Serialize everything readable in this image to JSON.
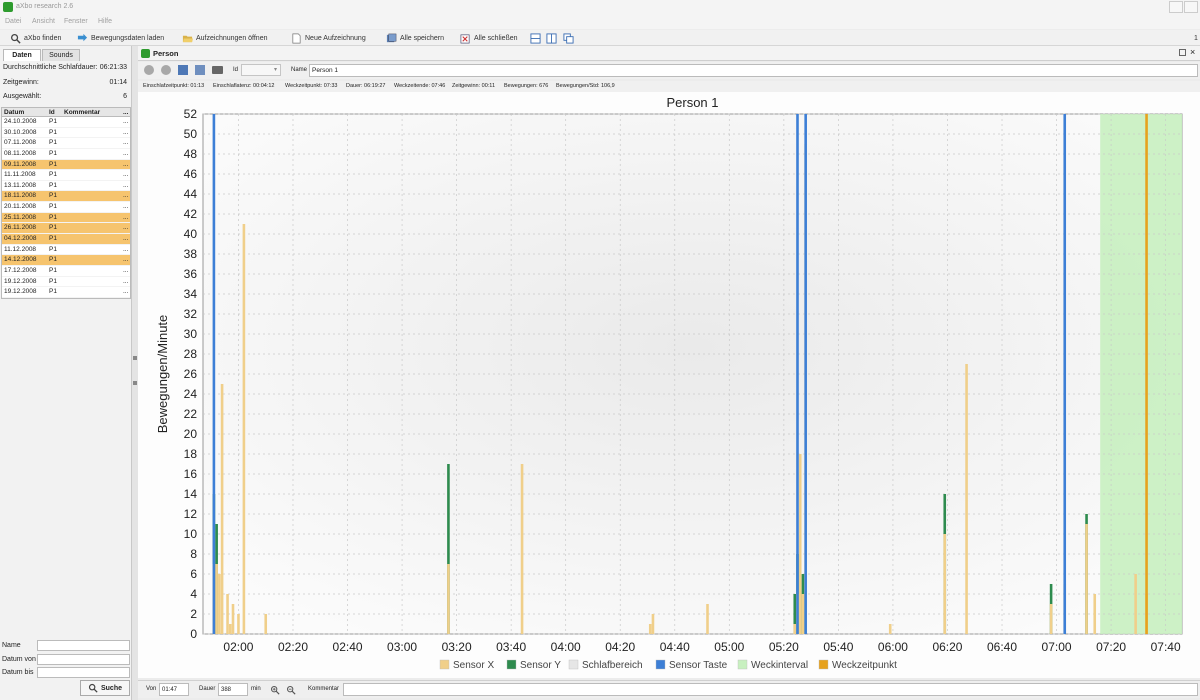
{
  "window": {
    "title": "aXbo research 2.6"
  },
  "menu": [
    "Datei",
    "Ansicht",
    "Fenster",
    "Hilfe"
  ],
  "toolbar": {
    "find": "aXbo finden",
    "load": "Bewegungsdaten laden",
    "open": "Aufzeichnungen öffnen",
    "new": "Neue Aufzeichnung",
    "save_all": "Alle speichern",
    "close_all": "Alle schließen",
    "corner": "1"
  },
  "left": {
    "tabs": [
      "Daten",
      "Sounds"
    ],
    "stats": [
      {
        "label": "Durchschnittliche Schlafdauer:",
        "value": "06:21:33"
      },
      {
        "label": "Zeitgewinn:",
        "value": "01:14"
      },
      {
        "label": "Ausgewählt:",
        "value": "6"
      }
    ],
    "table_headers": [
      "Datum",
      "Id",
      "Kommentar",
      "..."
    ],
    "rows": [
      {
        "date": "24.10.2008",
        "id": "P1",
        "more": "...",
        "hl": false
      },
      {
        "date": "30.10.2008",
        "id": "P1",
        "more": "...",
        "hl": false
      },
      {
        "date": "07.11.2008",
        "id": "P1",
        "more": "...",
        "hl": false
      },
      {
        "date": "08.11.2008",
        "id": "P1",
        "more": "...",
        "hl": false
      },
      {
        "date": "09.11.2008",
        "id": "P1",
        "more": "...",
        "hl": true
      },
      {
        "date": "11.11.2008",
        "id": "P1",
        "more": "...",
        "hl": false
      },
      {
        "date": "13.11.2008",
        "id": "P1",
        "more": "...",
        "hl": false
      },
      {
        "date": "18.11.2008",
        "id": "P1",
        "more": "...",
        "hl": true
      },
      {
        "date": "20.11.2008",
        "id": "P1",
        "more": "...",
        "hl": false
      },
      {
        "date": "25.11.2008",
        "id": "P1",
        "more": "...",
        "hl": true
      },
      {
        "date": "26.11.2008",
        "id": "P1",
        "more": "...",
        "hl": true
      },
      {
        "date": "04.12.2008",
        "id": "P1",
        "more": "...",
        "hl": true
      },
      {
        "date": "11.12.2008",
        "id": "P1",
        "more": "...",
        "hl": false
      },
      {
        "date": "14.12.2008",
        "id": "P1",
        "more": "...",
        "hl": true
      },
      {
        "date": "17.12.2008",
        "id": "P1",
        "more": "...",
        "hl": false
      },
      {
        "date": "19.12.2008",
        "id": "P1",
        "more": "...",
        "hl": false
      },
      {
        "date": "19.12.2008",
        "id": "P1",
        "more": "...",
        "hl": false
      }
    ],
    "filter_labels": [
      "Name",
      "Datum von",
      "Datum bis"
    ],
    "search_label": "Suche"
  },
  "panel": {
    "title": "Person",
    "id_label": "Id",
    "name_label": "Name",
    "name_value": "Person 1"
  },
  "info": [
    "Einschlafzeitpunkt: 01:13",
    "Einschlaflatenz: 00:04:12",
    "Weckzeitpunkt: 07:33",
    "Dauer: 06:19:27",
    "Weckzeitende: 07:46",
    "Zeitgewinn: 00:11",
    "Bewegungen: 676",
    "Bewegungen/Std: 106,9"
  ],
  "bottom": {
    "von_label": "Von",
    "von_value": "01:47",
    "dauer_label": "Dauer",
    "dauer_value": "388",
    "unit": "min",
    "kommentar_label": "Kommentar"
  },
  "colors": {
    "sensor_x": "#f0cf8a",
    "sensor_y": "#2e8b4e",
    "schlafbereich": "#e6e6e6",
    "sensor_taste": "#3d7fd6",
    "weckinterval": "#c8f0c0",
    "weckzeitpunkt": "#e6a21e"
  },
  "chart_data": {
    "type": "bar",
    "title": "Person 1",
    "ylabel": "Bewegungen/Minute",
    "xlabel": "",
    "ylim": [
      0,
      52
    ],
    "xlim": [
      "01:47",
      "07:46"
    ],
    "yticks": [
      0,
      2,
      4,
      6,
      8,
      10,
      12,
      14,
      16,
      18,
      20,
      22,
      24,
      26,
      28,
      30,
      32,
      34,
      36,
      38,
      40,
      42,
      44,
      46,
      48,
      50,
      52
    ],
    "xticks": [
      "02:00",
      "02:20",
      "02:40",
      "03:00",
      "03:20",
      "03:40",
      "04:00",
      "04:20",
      "04:40",
      "05:00",
      "05:20",
      "05:40",
      "06:00",
      "06:20",
      "06:40",
      "07:00",
      "07:20",
      "07:40"
    ],
    "grid": true,
    "legend_position": "bottom",
    "legend": [
      "Sensor X",
      "Sensor Y",
      "Schlafbereich",
      "Sensor Taste",
      "Weckinterval",
      "Weckzeitpunkt"
    ],
    "series": [
      {
        "name": "Sensor X",
        "points": [
          [
            "01:51",
            7
          ],
          [
            "01:52",
            7
          ],
          [
            "01:53",
            6
          ],
          [
            "01:54",
            25
          ],
          [
            "01:56",
            4
          ],
          [
            "01:57",
            1
          ],
          [
            "01:58",
            3
          ],
          [
            "02:00",
            2
          ],
          [
            "02:02",
            41
          ],
          [
            "02:10",
            2
          ],
          [
            "03:17",
            7
          ],
          [
            "03:44",
            17
          ],
          [
            "04:31",
            1
          ],
          [
            "04:32",
            2
          ],
          [
            "04:52",
            3
          ],
          [
            "05:24",
            1
          ],
          [
            "05:25",
            4
          ],
          [
            "05:26",
            18
          ],
          [
            "05:27",
            4
          ],
          [
            "05:28",
            49
          ],
          [
            "05:59",
            1
          ],
          [
            "06:19",
            10
          ],
          [
            "06:27",
            27
          ],
          [
            "06:58",
            3
          ],
          [
            "07:03",
            5
          ],
          [
            "07:11",
            11
          ],
          [
            "07:14",
            4
          ],
          [
            "07:29",
            6
          ],
          [
            "07:33",
            4
          ]
        ]
      },
      {
        "name": "Sensor Y",
        "points": [
          [
            "01:51",
            14
          ],
          [
            "01:52",
            11
          ],
          [
            "03:17",
            17
          ],
          [
            "05:24",
            4
          ],
          [
            "05:25",
            8
          ],
          [
            "05:27",
            6
          ],
          [
            "06:19",
            14
          ],
          [
            "06:58",
            5
          ],
          [
            "07:11",
            12
          ]
        ]
      },
      {
        "name": "Sensor Taste",
        "points": [
          [
            "01:51",
            52
          ],
          [
            "05:25",
            52
          ],
          [
            "05:28",
            52
          ],
          [
            "07:03",
            52
          ]
        ]
      },
      {
        "name": "Weckinterval",
        "range": [
          "07:16",
          "07:46"
        ]
      },
      {
        "name": "Weckzeitpunkt",
        "points": [
          [
            "07:33",
            52
          ]
        ]
      }
    ]
  }
}
